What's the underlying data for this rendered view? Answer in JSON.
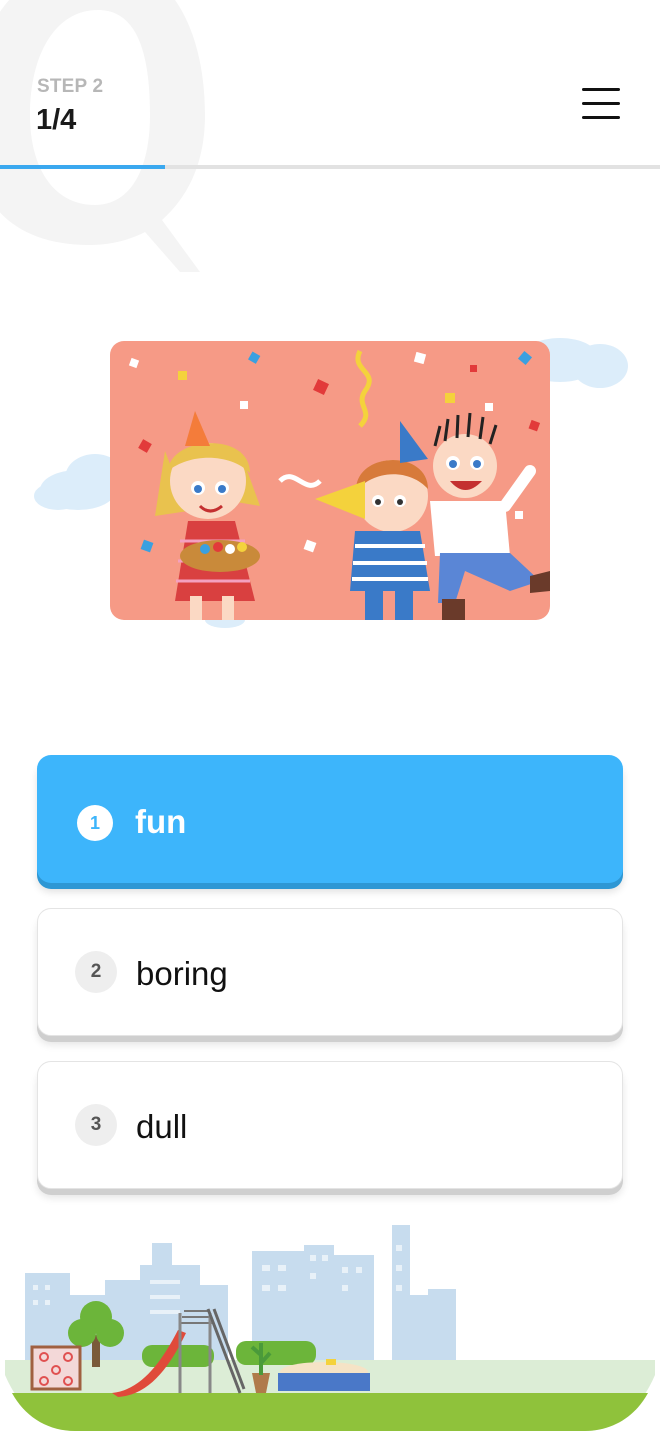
{
  "header": {
    "step_label": "STEP 2",
    "progress_text": "1/4",
    "progress_fraction": 0.25
  },
  "illustration": {
    "subject": "party-kids-illustration"
  },
  "options": [
    {
      "number": "1",
      "text": "fun",
      "selected": true
    },
    {
      "number": "2",
      "text": "boring",
      "selected": false
    },
    {
      "number": "3",
      "text": "dull",
      "selected": false
    }
  ],
  "colors": {
    "accent": "#3db5fb",
    "progress": "#3aa8ef",
    "illustration_bg": "#f69a86",
    "ground": "#8fc23b"
  },
  "icons": {
    "menu": "hamburger-menu-icon",
    "watermark": "q-letter-watermark"
  }
}
